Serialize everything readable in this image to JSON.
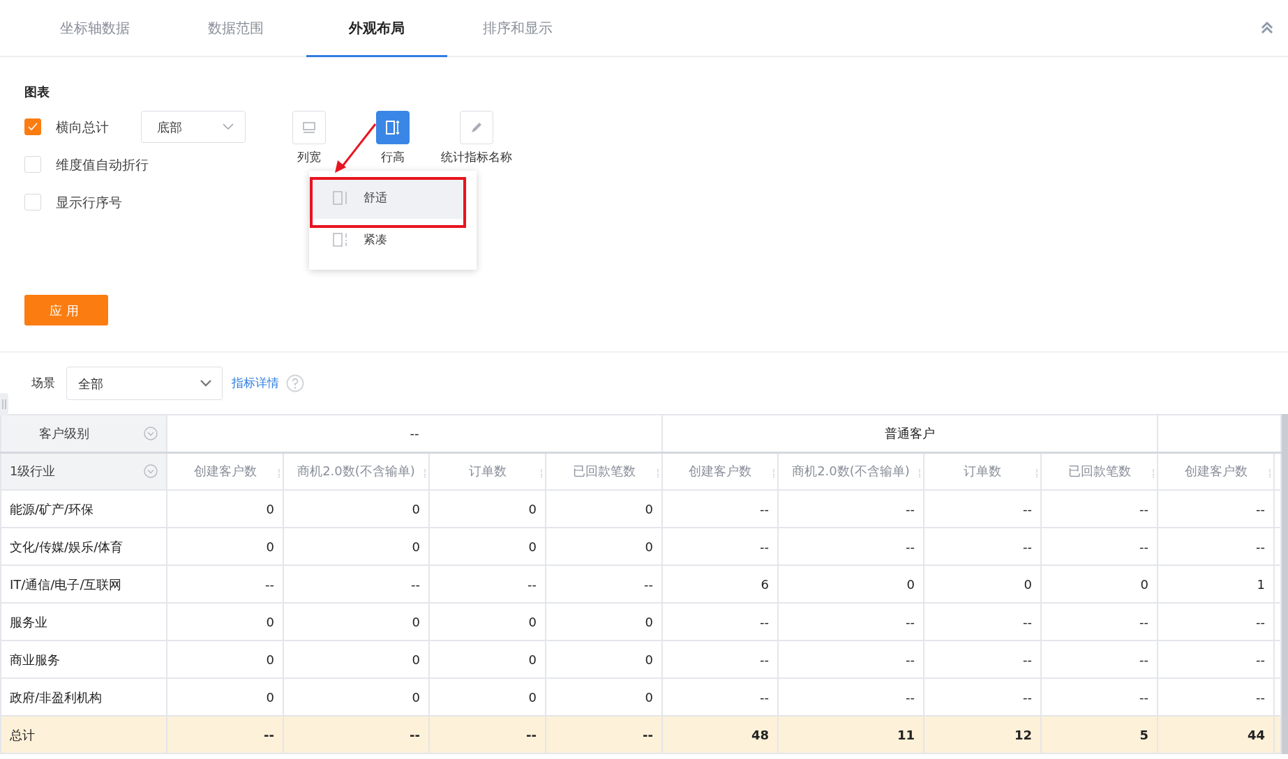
{
  "tabs": [
    {
      "label": "坐标轴数据",
      "selected": false
    },
    {
      "label": "数据范围",
      "selected": false
    },
    {
      "label": "外观布局",
      "selected": true
    },
    {
      "label": "排序和显示",
      "selected": false
    }
  ],
  "chart_settings": {
    "title": "图表",
    "options": [
      {
        "label": "横向总计",
        "checked": true,
        "position_select": "底部"
      },
      {
        "label": "维度值自动折行",
        "checked": false
      },
      {
        "label": "显示行序号",
        "checked": false
      }
    ],
    "toolbar": [
      {
        "kind": "column-width",
        "label": "列宽",
        "selected": false
      },
      {
        "kind": "row-height",
        "label": "行高",
        "selected": true
      },
      {
        "kind": "edit",
        "label": "统计指标名称",
        "selected": false
      }
    ],
    "row_height_menu": [
      {
        "kind": "comfortable",
        "label": "舒适",
        "selected": true
      },
      {
        "kind": "compact",
        "label": "紧凑",
        "selected": false
      }
    ],
    "apply_button": "应用"
  },
  "filter": {
    "label": "场景",
    "select_value": "全部",
    "link": "指标详情"
  },
  "table": {
    "row_headers": [
      "客户级别",
      "1级行业"
    ],
    "column_groups": [
      "--",
      "普通客户"
    ],
    "metrics": [
      "创建客户数",
      "商机2.0数(不含输单)",
      "订单数",
      "已回款笔数",
      "创建客户数",
      "商机2.0数(不含输单)",
      "订单数",
      "已回款笔数",
      "创建客户数"
    ],
    "rows": [
      {
        "label": "能源/矿产/环保",
        "cells": [
          "0",
          "0",
          "0",
          "0",
          "--",
          "--",
          "--",
          "--",
          "--"
        ]
      },
      {
        "label": "文化/传媒/娱乐/体育",
        "cells": [
          "0",
          "0",
          "0",
          "0",
          "--",
          "--",
          "--",
          "--",
          "--"
        ]
      },
      {
        "label": "IT/通信/电子/互联网",
        "cells": [
          "--",
          "--",
          "--",
          "--",
          "6",
          "0",
          "0",
          "0",
          "1"
        ]
      },
      {
        "label": "服务业",
        "cells": [
          "0",
          "0",
          "0",
          "0",
          "--",
          "--",
          "--",
          "--",
          "--"
        ]
      },
      {
        "label": "商业服务",
        "cells": [
          "0",
          "0",
          "0",
          "0",
          "--",
          "--",
          "--",
          "--",
          "--"
        ]
      },
      {
        "label": "政府/非盈利机构",
        "cells": [
          "0",
          "0",
          "0",
          "0",
          "--",
          "--",
          "--",
          "--",
          "--"
        ]
      }
    ],
    "total": {
      "label": "总计",
      "cells": [
        "--",
        "--",
        "--",
        "--",
        "48",
        "11",
        "12",
        "5",
        "44"
      ]
    }
  }
}
